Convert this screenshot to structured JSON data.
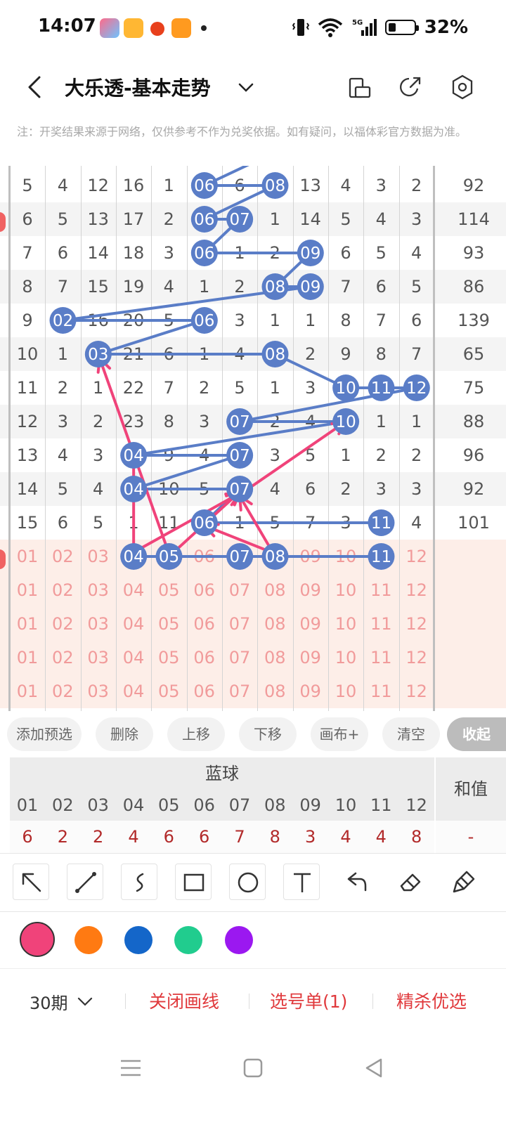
{
  "status": {
    "time": "14:07",
    "battery_pct": "32%",
    "network": "5G",
    "battery_level": 0.32
  },
  "header": {
    "title": "大乐透-基本走势"
  },
  "notice": "注：开奖结果来源于网络，仅供参考不作为兑奖依据。如有疑问，以福体彩官方数据为准。",
  "chart": {
    "history": [
      {
        "cells": [
          "5",
          "4",
          "12",
          "16",
          "1",
          "06",
          "6",
          "08",
          "13",
          "4",
          "3",
          "2"
        ],
        "sum": "92"
      },
      {
        "cells": [
          "6",
          "5",
          "13",
          "17",
          "2",
          "06",
          "07",
          "1",
          "14",
          "5",
          "4",
          "3"
        ],
        "sum": "114"
      },
      {
        "cells": [
          "7",
          "6",
          "14",
          "18",
          "3",
          "06",
          "1",
          "2",
          "09",
          "6",
          "5",
          "4"
        ],
        "sum": "93"
      },
      {
        "cells": [
          "8",
          "7",
          "15",
          "19",
          "4",
          "1",
          "2",
          "08",
          "09",
          "7",
          "6",
          "5"
        ],
        "sum": "86"
      },
      {
        "cells": [
          "9",
          "02",
          "16",
          "20",
          "5",
          "06",
          "3",
          "1",
          "1",
          "8",
          "7",
          "6"
        ],
        "sum": "139"
      },
      {
        "cells": [
          "10",
          "1",
          "03",
          "21",
          "6",
          "1",
          "4",
          "08",
          "2",
          "9",
          "8",
          "7"
        ],
        "sum": "65"
      },
      {
        "cells": [
          "11",
          "2",
          "1",
          "22",
          "7",
          "2",
          "5",
          "1",
          "3",
          "10",
          "11",
          "12"
        ],
        "sum": "75"
      },
      {
        "cells": [
          "12",
          "3",
          "2",
          "23",
          "8",
          "3",
          "07",
          "2",
          "4",
          "10",
          "1",
          "1"
        ],
        "sum": "88"
      },
      {
        "cells": [
          "13",
          "4",
          "3",
          "04",
          "9",
          "4",
          "07",
          "3",
          "5",
          "1",
          "2",
          "2"
        ],
        "sum": "96"
      },
      {
        "cells": [
          "14",
          "5",
          "4",
          "04",
          "10",
          "5",
          "07",
          "4",
          "6",
          "2",
          "3",
          "3"
        ],
        "sum": "92"
      },
      {
        "cells": [
          "15",
          "6",
          "5",
          "1",
          "11",
          "06",
          "1",
          "5",
          "7",
          "3",
          "11",
          "4"
        ],
        "sum": "101"
      }
    ],
    "selection_row": {
      "cells": [
        "01",
        "02",
        "03",
        "04",
        "05",
        "06",
        "07",
        "08",
        "09",
        "10",
        "11",
        "12"
      ],
      "selected": [
        "04",
        "05",
        "07",
        "08",
        "11"
      ]
    },
    "preselect_rows": [
      [
        "01",
        "02",
        "03",
        "04",
        "05",
        "06",
        "07",
        "08",
        "09",
        "10",
        "11",
        "12"
      ],
      [
        "01",
        "02",
        "03",
        "04",
        "05",
        "06",
        "07",
        "08",
        "09",
        "10",
        "11",
        "12"
      ],
      [
        "01",
        "02",
        "03",
        "04",
        "05",
        "06",
        "07",
        "08",
        "09",
        "10",
        "11",
        "12"
      ],
      [
        "01",
        "02",
        "03",
        "04",
        "05",
        "06",
        "07",
        "08",
        "09",
        "10",
        "11",
        "12"
      ]
    ],
    "ball_color": "#5a7dc7",
    "line_color": "#5a7dc7",
    "draw_color": "#f0437a"
  },
  "actions": {
    "add": "添加预选",
    "delete": "删除",
    "up": "上移",
    "down": "下移",
    "canvas": "画布+",
    "clear": "清空",
    "collapse": "收起"
  },
  "blue": {
    "title": "蓝球",
    "sum_title": "和值",
    "numbers": [
      "01",
      "02",
      "03",
      "04",
      "05",
      "06",
      "07",
      "08",
      "09",
      "10",
      "11",
      "12"
    ],
    "values": [
      "6",
      "2",
      "2",
      "4",
      "6",
      "6",
      "7",
      "8",
      "3",
      "4",
      "4",
      "8"
    ],
    "sum_value": "-"
  },
  "draw_tools": [
    {
      "name": "arrow-tool-icon"
    },
    {
      "name": "line-tool-icon"
    },
    {
      "name": "freehand-tool-icon"
    },
    {
      "name": "rectangle-tool-icon"
    },
    {
      "name": "circle-tool-icon"
    },
    {
      "name": "text-tool-icon"
    },
    {
      "name": "undo-icon"
    },
    {
      "name": "eraser-icon"
    },
    {
      "name": "clear-brush-icon"
    }
  ],
  "colors": [
    "#f0437a",
    "#ff7a12",
    "#1466c9",
    "#21cc8e",
    "#9b18f0"
  ],
  "bottom": {
    "period": "30期",
    "close_draw": "关闭画线",
    "pick_list": "选号单(1)",
    "best_pick": "精杀优选"
  }
}
